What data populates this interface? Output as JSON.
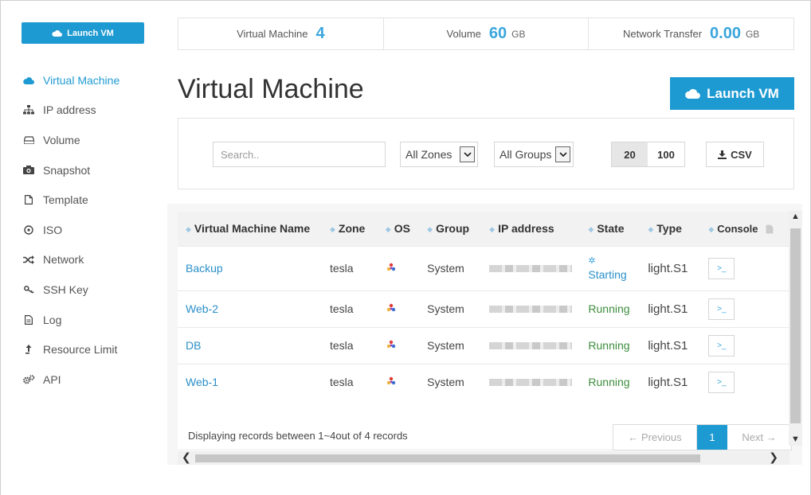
{
  "sidebar": {
    "launch_label": "Launch VM",
    "items": [
      {
        "label": "Virtual Machine",
        "icon": "cloud-icon",
        "active": true
      },
      {
        "label": "IP address",
        "icon": "sitemap-icon"
      },
      {
        "label": "Volume",
        "icon": "hdd-icon"
      },
      {
        "label": "Snapshot",
        "icon": "camera-icon"
      },
      {
        "label": "Template",
        "icon": "file-icon"
      },
      {
        "label": "ISO",
        "icon": "disc-icon"
      },
      {
        "label": "Network",
        "icon": "shuffle-icon"
      },
      {
        "label": "SSH Key",
        "icon": "key-icon"
      },
      {
        "label": "Log",
        "icon": "document-icon"
      },
      {
        "label": "Resource Limit",
        "icon": "upload-arrow-icon"
      },
      {
        "label": "API",
        "icon": "gears-icon"
      }
    ]
  },
  "stats": {
    "vm_label": "Virtual Machine",
    "vm_value": "4",
    "volume_label": "Volume",
    "volume_value": "60",
    "volume_unit": "GB",
    "transfer_label": "Network Transfer",
    "transfer_value": "0.00",
    "transfer_unit": "GB"
  },
  "page": {
    "title": "Virtual Machine",
    "launch_label": "Launch VM"
  },
  "filters": {
    "search_placeholder": "Search..",
    "zone_selected": "All Zones",
    "group_selected": "All Groups",
    "page_size_options": [
      "20",
      "100"
    ],
    "page_size_selected": "20",
    "csv_label": "CSV"
  },
  "table": {
    "columns": [
      "Virtual Machine Name",
      "Zone",
      "OS",
      "Group",
      "IP address",
      "State",
      "Type",
      "Console"
    ],
    "rows": [
      {
        "name": "Backup",
        "zone": "tesla",
        "group": "System",
        "state": "Starting",
        "type": "light.S1"
      },
      {
        "name": "Web-2",
        "zone": "tesla",
        "group": "System",
        "state": "Running",
        "type": "light.S1"
      },
      {
        "name": "DB",
        "zone": "tesla",
        "group": "System",
        "state": "Running",
        "type": "light.S1"
      },
      {
        "name": "Web-1",
        "zone": "tesla",
        "group": "System",
        "state": "Running",
        "type": "light.S1"
      }
    ]
  },
  "footer": {
    "records_text": "Displaying records between 1~4out of 4 records",
    "prev_label": "← Previous",
    "current_page": "1",
    "next_label": "Next →"
  },
  "colors": {
    "accent": "#1e9ad2",
    "running": "#3c8d3c"
  }
}
